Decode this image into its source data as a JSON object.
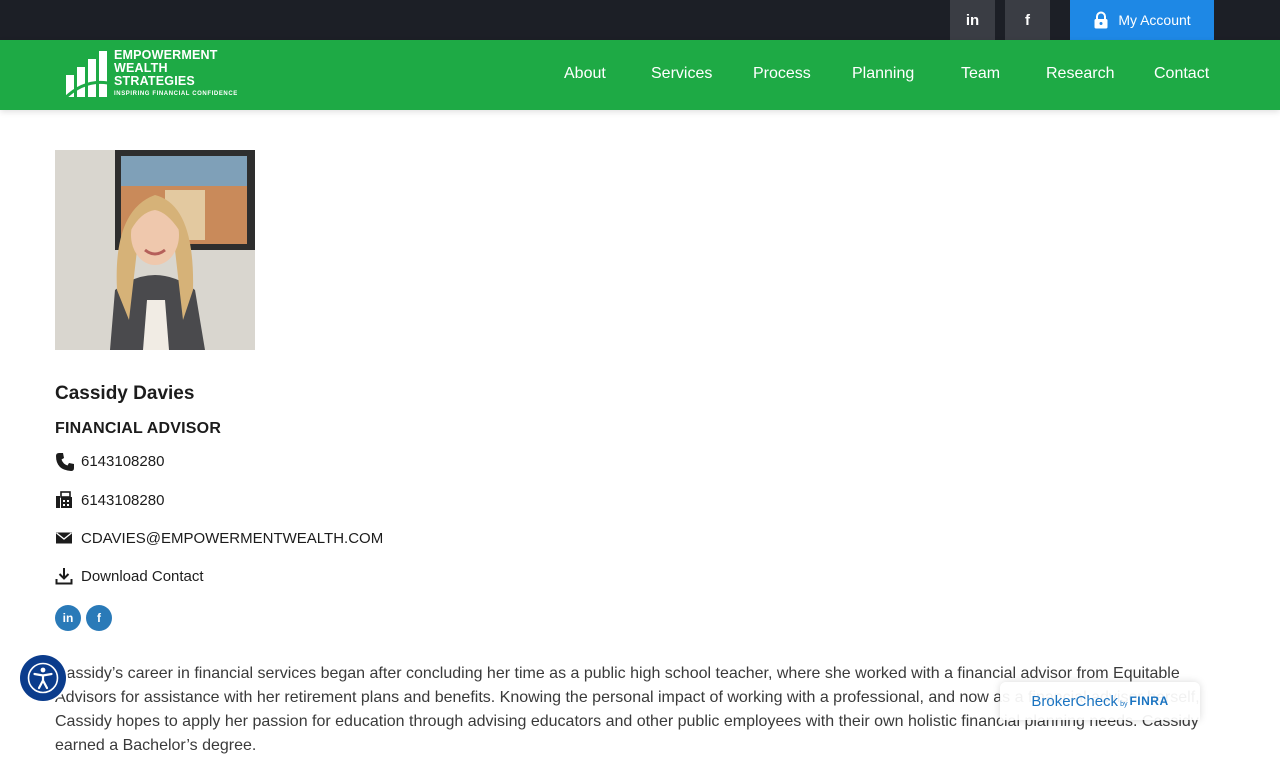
{
  "topbar": {
    "linkedin_icon": "linkedin-icon",
    "facebook_icon": "facebook-icon",
    "linkedin_glyph": "in",
    "facebook_glyph": "f",
    "account_label": "My Account"
  },
  "logo": {
    "line1": "EMPOWERMENT",
    "line2": "WEALTH",
    "line3": "STRATEGIES",
    "tagline": "INSPIRING FINANCIAL CONFIDENCE"
  },
  "nav": {
    "items": [
      {
        "label": "About"
      },
      {
        "label": "Services"
      },
      {
        "label": "Process"
      },
      {
        "label": "Planning"
      },
      {
        "label": "Team"
      },
      {
        "label": "Research"
      },
      {
        "label": "Contact"
      }
    ]
  },
  "profile": {
    "name": "Cassidy Davies",
    "role": "FINANCIAL ADVISOR",
    "phone": "6143108280",
    "fax": "6143108280",
    "email": "CDAVIES@EMPOWERMENTWEALTH.COM",
    "download": "Download Contact",
    "social_li": "in",
    "social_fb": "f"
  },
  "bio": {
    "text": "Cassidy’s career in financial services began after concluding her time as a public high school teacher, where she worked with a financial advisor from Equitable Advisors for assistance with her retirement plans and benefits. Knowing the personal impact of working with a professional, and now as a financial advisor herself, Cassidy hopes to apply her passion for education through advising educators and other public employees with their own holistic financial planning needs. Cassidy earned a Bachelor’s degree."
  },
  "brokercheck": {
    "brand": "BrokerCheck",
    "by": "by",
    "finra": "FINRA"
  },
  "colors": {
    "topbar": "#1c1f26",
    "nav_green": "#1eaa45",
    "account_blue": "#1e88e5",
    "social_blue": "#2a7ab8",
    "a11y_blue": "#0b3c8c"
  }
}
